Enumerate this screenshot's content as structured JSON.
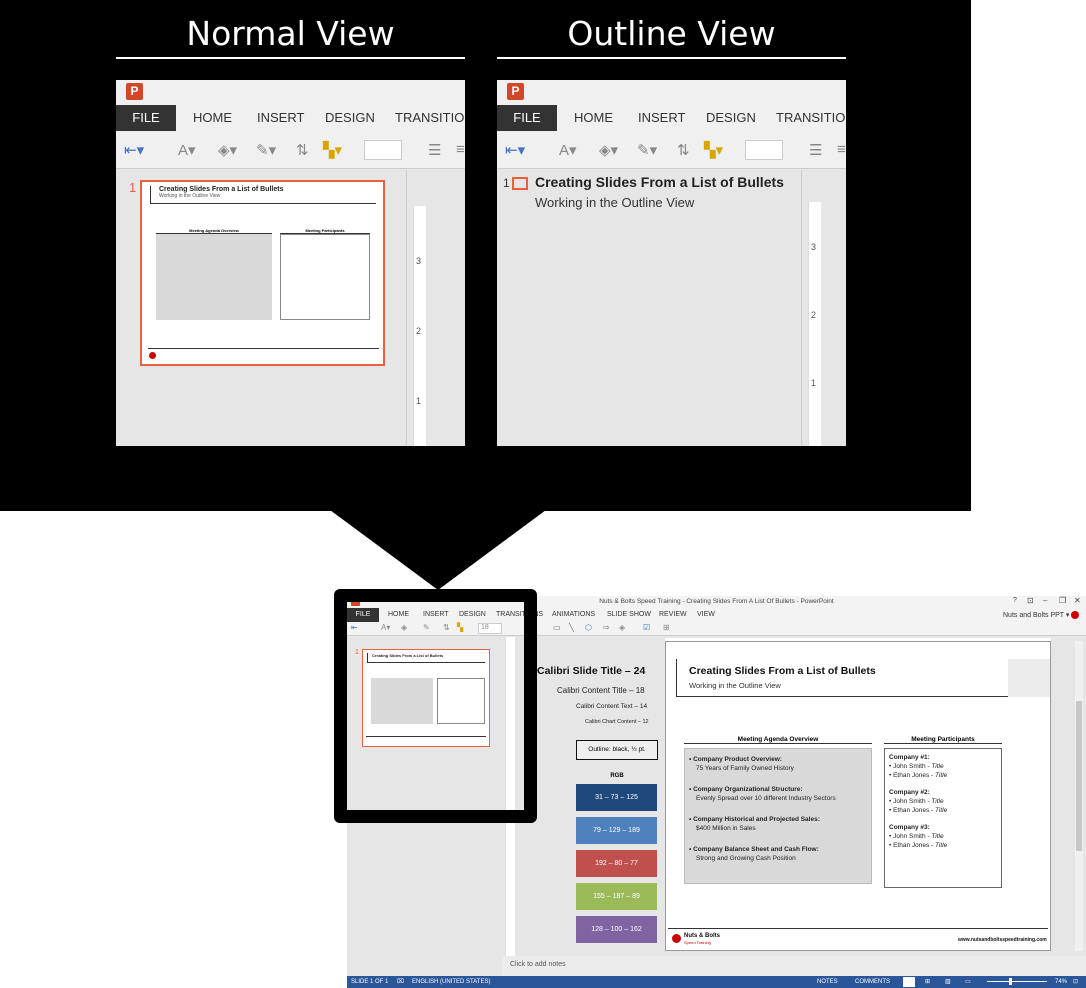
{
  "headings": {
    "normal": "Normal View",
    "outline": "Outline View"
  },
  "ribbon_tabs": [
    "FILE",
    "HOME",
    "INSERT",
    "DESIGN",
    "TRANSITIONS"
  ],
  "normal_pane": {
    "slide_number": "1",
    "slide_title": "Creating Slides From a List of Bullets",
    "slide_subtitle": "Working in the Outline View",
    "agenda_header": "Meeting Agenda Overview",
    "participants_header": "Meeting Participants",
    "ruler_marks": [
      "3",
      "2",
      "1"
    ]
  },
  "outline_pane": {
    "slide_number": "1",
    "title": "Creating Slides From a List of Bullets",
    "subtitle": "Working in the Outline View",
    "ruler_marks": [
      "3",
      "2",
      "1"
    ]
  },
  "ppt": {
    "window_title": "Nuts & Bolts Speed Training - Creating Slides From A List Of Bullets - PowerPoint",
    "account": "Nuts and Bolts PPT ▾",
    "tabs": [
      "FILE",
      "HOME",
      "INSERT",
      "DESIGN",
      "TRANSITIONS",
      "ANIMATIONS",
      "SLIDE SHOW",
      "REVIEW",
      "VIEW"
    ],
    "font_size_value": "18",
    "guide": {
      "slide_title": "Calibri  Slide Title – 24",
      "content_title": "Calibri Content Title – 18",
      "content_text": "Calibri  Content  Text – 14",
      "chart_content": "Calibri Chart  Content – 12",
      "outline": "Outline: black, ½ pt.",
      "rgb_label": "RGB",
      "swatches": [
        {
          "label": "31 – 73 – 125",
          "color": "#1f497d"
        },
        {
          "label": "79 – 129 – 189",
          "color": "#4f81bd"
        },
        {
          "label": "192 – 80 – 77",
          "color": "#c0504d"
        },
        {
          "label": "155 – 187 – 89",
          "color": "#9bbb59"
        },
        {
          "label": "128 – 100 – 162",
          "color": "#8064a2"
        }
      ]
    },
    "slide": {
      "title": "Creating Slides From a List of Bullets",
      "subtitle": "Working in the Outline View",
      "agenda_header": "Meeting Agenda Overview",
      "participants_header": "Meeting Participants",
      "agenda": [
        {
          "head": "Company Product Overview:",
          "text": "75 Years of Family Owned History"
        },
        {
          "head": "Company Organizational Structure:",
          "text": "Evenly Spread over 10 different Industry Sectors"
        },
        {
          "head": "Company Historical and Projected Sales:",
          "text": "$400 Million in Sales"
        },
        {
          "head": "Company Balance Sheet and Cash Flow:",
          "text": "Strong and Growing Cash Position"
        }
      ],
      "companies": [
        {
          "name": "Company #1:",
          "people": [
            "John Smith - ",
            "Ethan Jones - "
          ]
        },
        {
          "name": "Company #2:",
          "people": [
            "John Smith - ",
            "Ethan Jones - "
          ]
        },
        {
          "name": "Company #3:",
          "people": [
            "John Smith - ",
            "Ethan Jones - "
          ]
        }
      ],
      "title_word": "Title",
      "logo_text": "Nuts & Bolts",
      "logo_sub": "Speed Training",
      "url": "www.nutsandboltsspeedtraining.com"
    },
    "notes_placeholder": "Click to add notes",
    "status": {
      "slide": "SLIDE 1 OF 1",
      "language": "ENGLISH (UNITED STATES)",
      "notes": "NOTES",
      "comments": "COMMENTS",
      "zoom": "74%"
    },
    "thumb_number": "1"
  },
  "colors": {
    "accent": "#e8613a",
    "file_tab": "#333333",
    "status_bar": "#2b579a"
  }
}
